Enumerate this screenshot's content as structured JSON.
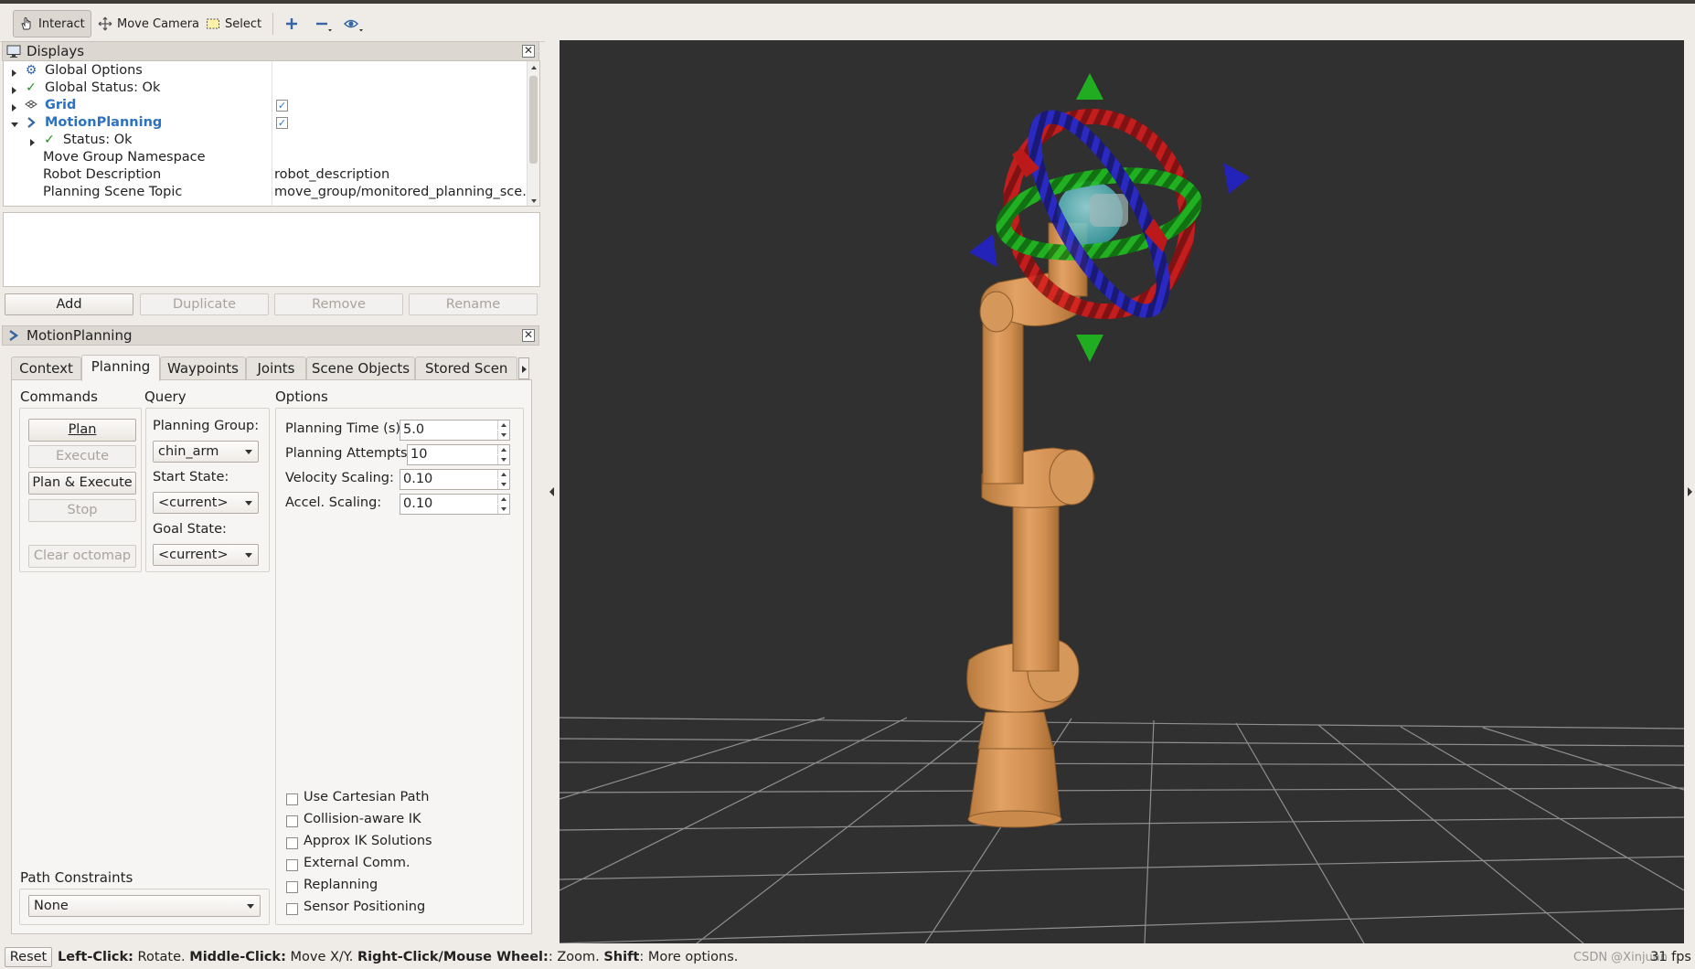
{
  "toolbar": {
    "interact": "Interact",
    "move_camera": "Move Camera",
    "select": "Select"
  },
  "displays_panel": {
    "title": "Displays",
    "tree": [
      {
        "label": "Global Options",
        "value": ""
      },
      {
        "label": "Global Status: Ok",
        "value": ""
      },
      {
        "label": "Grid",
        "value": "",
        "checked": true
      },
      {
        "label": "MotionPlanning",
        "value": "",
        "checked": true
      },
      {
        "label": "Status: Ok",
        "value": ""
      },
      {
        "label": "Move Group Namespace",
        "value": ""
      },
      {
        "label": "Robot Description",
        "value": "robot_description"
      },
      {
        "label": "Planning Scene Topic",
        "value": "move_group/monitored_planning_sce…"
      }
    ],
    "buttons": {
      "add": "Add",
      "duplicate": "Duplicate",
      "remove": "Remove",
      "rename": "Rename"
    }
  },
  "motion_panel": {
    "title": "MotionPlanning",
    "tabs": [
      "Context",
      "Planning",
      "Waypoints",
      "Joints",
      "Scene Objects",
      "Stored Scen"
    ],
    "active_tab": "Planning",
    "commands": {
      "title": "Commands",
      "plan": "Plan",
      "execute": "Execute",
      "plan_execute": "Plan & Execute",
      "stop": "Stop",
      "clear_octomap": "Clear octomap"
    },
    "query": {
      "title": "Query",
      "planning_group_label": "Planning Group:",
      "planning_group": "chin_arm",
      "start_state_label": "Start State:",
      "start_state": "<current>",
      "goal_state_label": "Goal State:",
      "goal_state": "<current>"
    },
    "options": {
      "title": "Options",
      "planning_time_label": "Planning Time (s):",
      "planning_time": "5.0",
      "planning_attempts_label": "Planning Attempts:",
      "planning_attempts": "10",
      "velocity_scaling_label": "Velocity Scaling:",
      "velocity_scaling": "0.10",
      "accel_scaling_label": "Accel. Scaling:",
      "accel_scaling": "0.10",
      "checkboxes": [
        "Use Cartesian Path",
        "Collision-aware IK",
        "Approx IK Solutions",
        "External Comm.",
        "Replanning",
        "Sensor Positioning"
      ]
    },
    "path_constraints": {
      "label": "Path Constraints",
      "value": "None"
    }
  },
  "statusbar": {
    "reset": "Reset",
    "k1": "Left-Click:",
    "t1": " Rotate. ",
    "k2": "Middle-Click:",
    "t2": " Move X/Y. ",
    "k3": "Right-Click/Mouse Wheel:",
    "t3": ": Zoom. ",
    "k4": "Shift",
    "t4": ": More options.",
    "watermark": "CSDN @Xinjuan",
    "fps": "31 fps"
  },
  "colors": {
    "viewport_bg": "#303030",
    "robot": "#d9924f",
    "x_axis": "#e01a1a",
    "y_axis": "#17b317",
    "z_axis": "#2020d0",
    "selection_link": "#2d72c0"
  }
}
